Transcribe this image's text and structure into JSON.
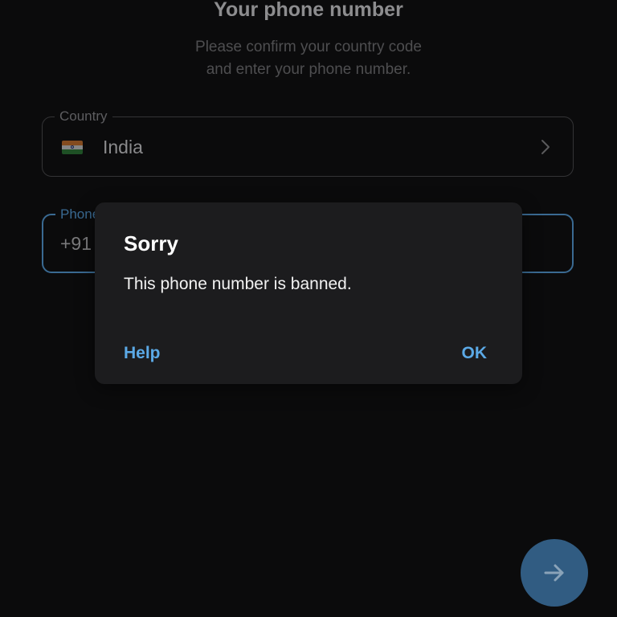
{
  "screen": {
    "title": "Your phone number",
    "subtitle_line1": "Please confirm your country code",
    "subtitle_line2": "and enter your phone number."
  },
  "country_field": {
    "label": "Country",
    "value": "India",
    "flag_icon": "india-flag-icon",
    "chevron_icon": "chevron-right-icon"
  },
  "phone_field": {
    "label_visible": "Phone",
    "country_code": "+91"
  },
  "next_button": {
    "icon": "arrow-right-icon",
    "color": "#315c82"
  },
  "dialog": {
    "title": "Sorry",
    "message": "This phone number is banned.",
    "help_label": "Help",
    "ok_label": "OK",
    "button_color": "#5ba9e6"
  }
}
